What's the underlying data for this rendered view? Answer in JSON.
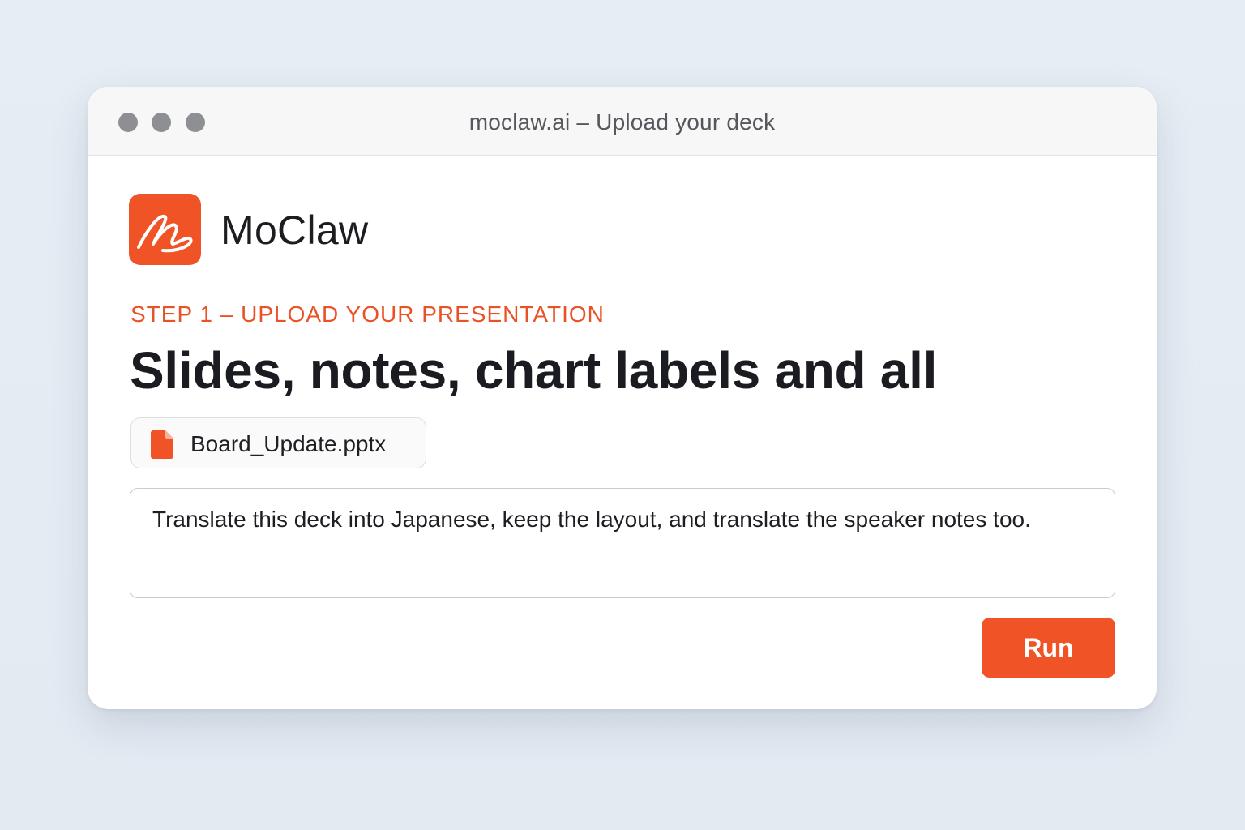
{
  "window": {
    "title": "moclaw.ai – Upload your deck"
  },
  "brand": {
    "name": "MoClaw",
    "logo_icon": "moclaw-scribble-icon",
    "accent_color": "#ef5326"
  },
  "step": {
    "label": "STEP 1 – UPLOAD YOUR PRESENTATION",
    "headline": "Slides, notes, chart labels and all"
  },
  "file": {
    "icon": "file-icon",
    "name": "Board_Update.pptx"
  },
  "prompt": {
    "value": "Translate this deck into Japanese, keep the layout, and translate the speaker notes too."
  },
  "actions": {
    "run_label": "Run"
  }
}
